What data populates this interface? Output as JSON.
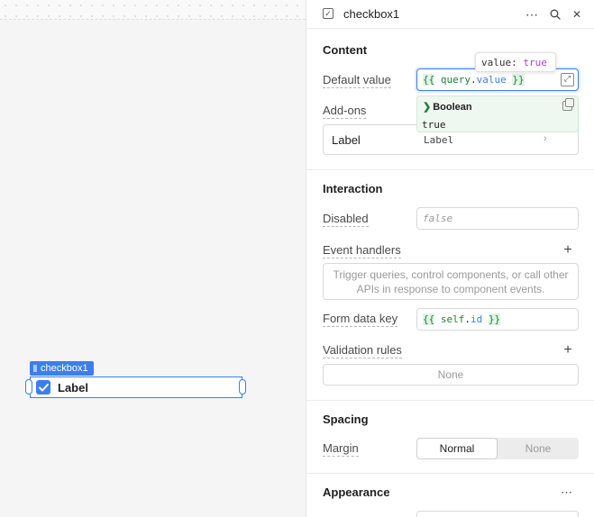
{
  "canvas": {
    "component_tag": "checkbox1",
    "checkbox_label": "Label",
    "checkbox_checked": true
  },
  "inspector": {
    "title": "checkbox1",
    "icons": [
      "checkbox-icon",
      "more-icon",
      "search-icon",
      "close-icon"
    ],
    "more_glyph": "⋯",
    "close_glyph": "✕",
    "search_glyph": "⌕"
  },
  "content": {
    "section_title": "Content",
    "default_value_label": "Default value",
    "default_value": {
      "open": "{{",
      "obj": "query",
      "dot": ".",
      "prop": "value",
      "close": "}}"
    },
    "tooltip": {
      "key": "value:",
      "value": "true"
    },
    "eval": {
      "type": "Boolean",
      "value": "true"
    },
    "addons_label": "Add-ons",
    "addon": {
      "name": "Label",
      "value": "Label"
    }
  },
  "interaction": {
    "section_title": "Interaction",
    "disabled_label": "Disabled",
    "disabled_placeholder": "false",
    "event_handlers_label": "Event handlers",
    "event_handlers_hint": "Trigger queries, control components, or call other APIs in response to component events.",
    "form_data_key_label": "Form data key",
    "form_data_key": {
      "open": "{{",
      "obj": "self",
      "dot": ".",
      "prop": "id",
      "close": "}}"
    },
    "validation_rules_label": "Validation rules",
    "validation_rules_value": "None"
  },
  "spacing": {
    "section_title": "Spacing",
    "margin_label": "Margin",
    "margin_options": [
      "Normal",
      "None"
    ],
    "margin_selected": "Normal"
  },
  "appearance": {
    "section_title": "Appearance"
  },
  "colors": {
    "accent": "#3d7eea",
    "code_green": "#1a7f37",
    "code_green_bg": "#e3f3e6",
    "boolean_purple": "#a742d4"
  }
}
